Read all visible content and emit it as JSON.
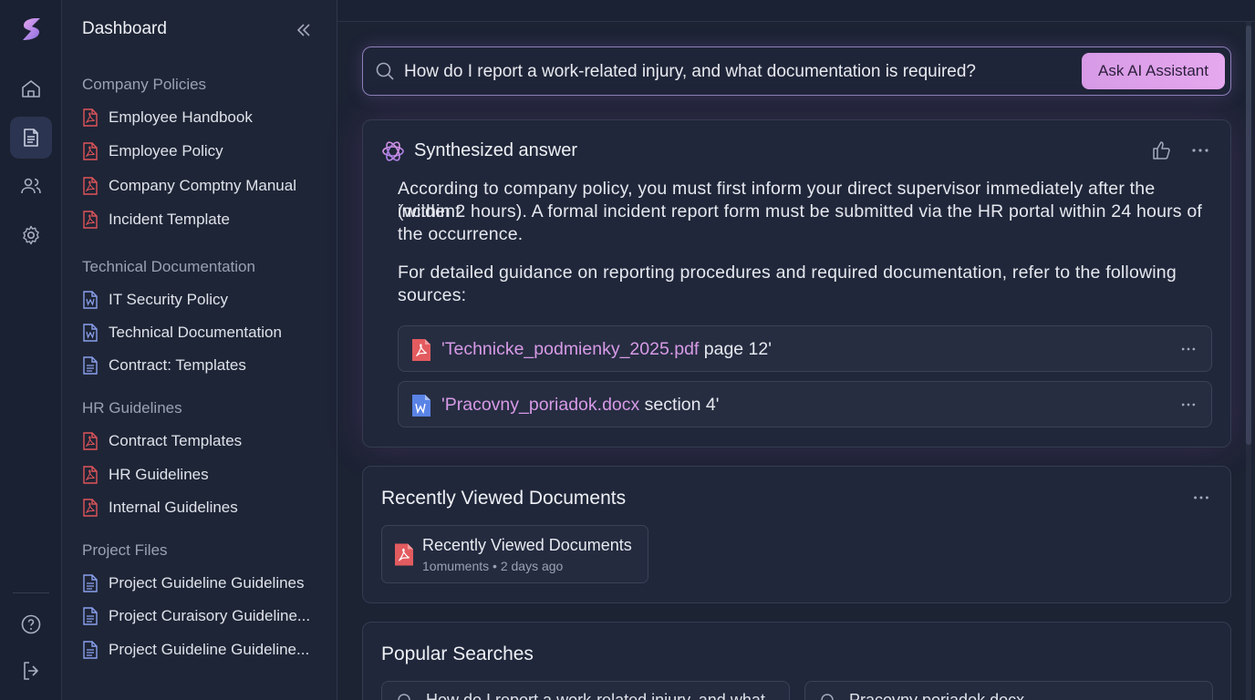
{
  "rail": {
    "items": [
      "home-icon",
      "document-icon",
      "users-icon",
      "settings-icon"
    ],
    "bottom": [
      "help-icon",
      "logout-icon"
    ]
  },
  "sidebar": {
    "title": "Dashboard",
    "sections": [
      {
        "label": "Company Policies",
        "items": [
          {
            "label": "Employee Handbook",
            "type": "pdf"
          },
          {
            "label": "Employee Policy",
            "type": "pdf"
          },
          {
            "label": "Company Comptny Manual",
            "type": "pdf"
          },
          {
            "label": "Incident Template",
            "type": "pdf"
          }
        ]
      },
      {
        "label": "Technical Documentation",
        "items": [
          {
            "label": "IT Security Policy",
            "type": "word"
          },
          {
            "label": "Technical Documentation",
            "type": "word"
          },
          {
            "label": "Contract: Templates",
            "type": "doc"
          }
        ]
      },
      {
        "label": "HR Guidelines",
        "items": [
          {
            "label": "Contract Templates",
            "type": "pdf"
          },
          {
            "label": "HR Guidelines",
            "type": "pdf"
          },
          {
            "label": "Internal Guidelines",
            "type": "pdf"
          }
        ]
      },
      {
        "label": "Project Files",
        "items": [
          {
            "label": "Project Guideline Guidelines",
            "type": "doc"
          },
          {
            "label": "Project Curaisory Guideline...",
            "type": "doc"
          },
          {
            "label": "Project Guideline Guideline...",
            "type": "doc"
          }
        ]
      }
    ]
  },
  "search": {
    "value": "How do I report a work-related injury, and what documentation is required?",
    "button_label": "Ask AI Assistant"
  },
  "answer": {
    "title": "Synthesized answer",
    "paragraph1_line1": "According to company policy, you must first inform your direct supervisor immediately after the incident",
    "paragraph1_line2": "(within 2 hours). A formal incident report form must be submitted via the HR portal within 24 hours of",
    "paragraph1_line3": "the occurrence.",
    "paragraph2_line1": "For detailed guidance on reporting procedures and required documentation, refer to the following",
    "paragraph2_line2": "sources:",
    "sources": [
      {
        "link": "'Technicke_podmienky_2025.pdf",
        "suffix": " page 12'",
        "type": "pdf"
      },
      {
        "link": "'Pracovny_poriadok.docx",
        "suffix": " section 4'",
        "type": "word"
      }
    ]
  },
  "recent": {
    "title": "Recently Viewed Documents",
    "items": [
      {
        "name": "Recently Viewed Documents",
        "meta": "1omuments • 2 days ago",
        "type": "pdf"
      }
    ]
  },
  "popular": {
    "title": "Popular Searches",
    "items": [
      {
        "label": "How do I report a work-related injury, and what"
      },
      {
        "label": "Pracovny poriadok.docx"
      }
    ]
  },
  "colors": {
    "accent": "#d79ae6",
    "background": "#1b2233",
    "card": "#20273a",
    "pdf_red": "#e0555a",
    "word_blue": "#6f8ee8"
  }
}
